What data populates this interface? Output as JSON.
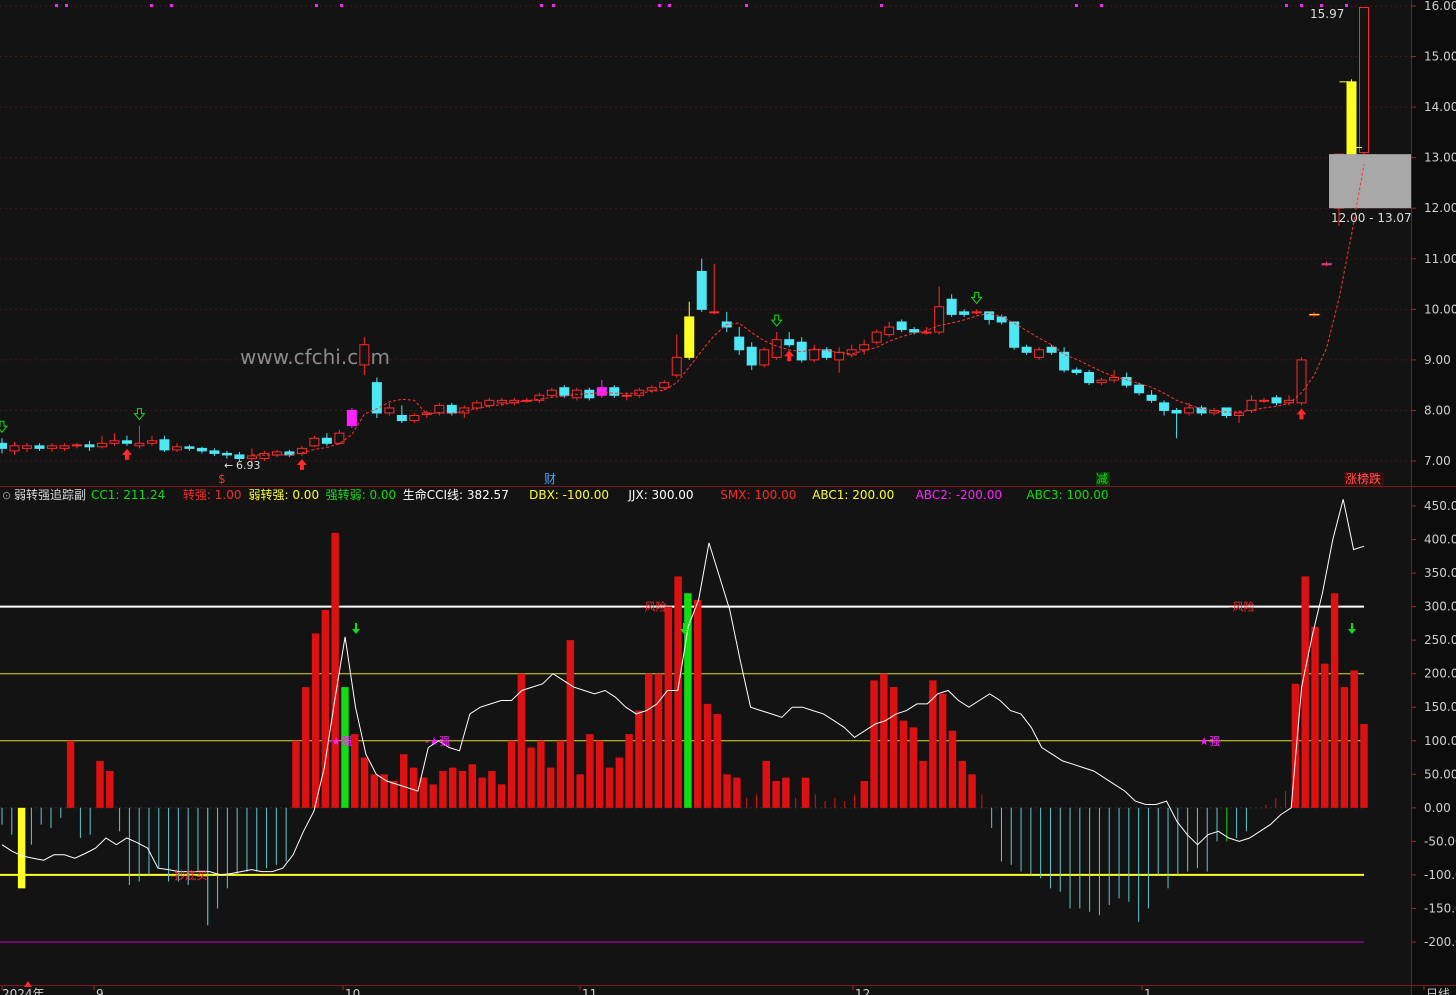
{
  "watermark": "www.cfchi.com",
  "colors": {
    "bg": "#141414",
    "axis_bg": "#0b0b0b",
    "grid": "#3a0f0f",
    "up": "#ff2a2a",
    "down": "#4ee7f5",
    "yellow": "#ffff22",
    "magenta": "#ff22ff",
    "green": "#11dd11",
    "white": "#ffffff",
    "purple": "#c000c0",
    "gray_box": "#a8a8a8"
  },
  "main_panel": {
    "y_ticks": [
      "16.00",
      "15.00",
      "14.00",
      "13.00",
      "12.00",
      "11.00",
      "10.00",
      "9.00",
      "8.00",
      "7.00"
    ],
    "low_label": "6.93",
    "high_label": "15.97",
    "range_label": "12.00 - 13.07",
    "event_labels": [
      {
        "text": "$",
        "color": "#ff2a2a"
      },
      {
        "text": "财",
        "color": "#4ea0ff"
      },
      {
        "text": "减",
        "color": "#11dd11"
      },
      {
        "text": "涨榜跌",
        "color": "#ff4444"
      }
    ]
  },
  "indicator": {
    "title": "弱转强追踪副",
    "values": [
      {
        "label": "CC1",
        "value": "211.24",
        "color": "#11dd11"
      },
      {
        "label": "转强",
        "value": "1.00",
        "color": "#ff2a2a"
      },
      {
        "label": "弱转强",
        "value": "0.00",
        "color": "#ffff22"
      },
      {
        "label": "强转弱",
        "value": "0.00",
        "color": "#11dd11"
      },
      {
        "label": "生命CCI线",
        "value": "382.57",
        "color": "#ffffff"
      },
      {
        "label": "DBX",
        "value": "-100.00",
        "color": "#ffff22"
      },
      {
        "label": "JJX",
        "value": "300.00",
        "color": "#ffffff"
      },
      {
        "label": "SMX",
        "value": "100.00",
        "color": "#ff2a2a"
      },
      {
        "label": "ABC1",
        "value": "200.00",
        "color": "#ffff22"
      },
      {
        "label": "ABC2",
        "value": "-200.00",
        "color": "#ff22ff"
      },
      {
        "label": "ABC3",
        "value": "100.00",
        "color": "#11dd11"
      }
    ],
    "y_ticks": [
      "450.00",
      "400.00",
      "350.00",
      "300.00",
      "250.00",
      "200.00",
      "150.00",
      "100.00",
      "50.00",
      "0.00",
      "-50.00",
      "-100.00",
      "-150.00",
      "-200.00"
    ],
    "annotations": [
      {
        "text": "-抄底买",
        "color": "#ff2a2a"
      },
      {
        "text": "-★强",
        "color": "#ff22ff"
      },
      {
        "text": "-★强",
        "color": "#ff22ff"
      },
      {
        "text": "-风险",
        "color": "#ff2a2a"
      },
      {
        "text": "★强",
        "color": "#ff22ff"
      },
      {
        "text": "-风险",
        "color": "#ff2a2a"
      }
    ]
  },
  "x_axis": {
    "labels": [
      "2024年",
      "9",
      "10",
      "11",
      "12",
      "1",
      "日线"
    ]
  },
  "chart_data": [
    {
      "type": "candlestick",
      "title": "",
      "y_ticks": [
        7,
        8,
        9,
        10,
        11,
        12,
        13,
        14,
        15,
        16
      ],
      "ylim": [
        6.75,
        16.1
      ],
      "grid": true,
      "candles": [
        [
          7.35,
          7.25,
          7.45,
          7.15
        ],
        [
          7.2,
          7.3,
          7.38,
          7.12
        ],
        [
          7.25,
          7.3,
          7.36,
          7.18
        ],
        [
          7.3,
          7.25,
          7.35,
          7.2
        ],
        [
          7.25,
          7.3,
          7.35,
          7.18
        ],
        [
          7.25,
          7.3,
          7.35,
          7.2
        ],
        [
          7.3,
          7.32,
          7.36,
          7.25
        ],
        [
          7.32,
          7.28,
          7.4,
          7.2
        ],
        [
          7.28,
          7.35,
          7.5,
          7.25
        ],
        [
          7.35,
          7.4,
          7.55,
          7.3
        ],
        [
          7.4,
          7.35,
          7.5,
          7.3
        ],
        [
          7.3,
          7.35,
          7.7,
          7.25
        ],
        [
          7.35,
          7.4,
          7.5,
          7.3
        ],
        [
          7.42,
          7.22,
          7.5,
          7.18
        ],
        [
          7.22,
          7.28,
          7.35,
          7.18
        ],
        [
          7.28,
          7.25,
          7.32,
          7.2
        ],
        [
          7.25,
          7.2,
          7.28,
          7.15
        ],
        [
          7.2,
          7.15,
          7.25,
          7.1
        ],
        [
          7.15,
          7.12,
          7.2,
          7.05
        ],
        [
          7.12,
          7.05,
          7.18,
          7.0
        ],
        [
          7.05,
          7.1,
          7.25,
          6.93
        ],
        [
          7.05,
          7.15,
          7.2,
          7.0
        ],
        [
          7.12,
          7.18,
          7.22,
          7.08
        ],
        [
          7.18,
          7.12,
          7.22,
          7.08
        ],
        [
          7.15,
          7.25,
          7.3,
          7.1
        ],
        [
          7.3,
          7.45,
          7.5,
          7.28
        ],
        [
          7.45,
          7.35,
          7.55,
          7.3
        ],
        [
          7.35,
          7.55,
          7.62,
          7.32
        ],
        [
          7.7,
          8.0,
          8.05,
          7.65
        ],
        [
          8.9,
          9.3,
          9.45,
          8.7
        ],
        [
          8.55,
          7.95,
          8.65,
          7.85
        ],
        [
          7.95,
          8.05,
          8.15,
          7.9
        ],
        [
          7.9,
          7.8,
          8.1,
          7.75
        ],
        [
          7.8,
          7.9,
          7.95,
          7.75
        ],
        [
          7.92,
          7.95,
          8.0,
          7.85
        ],
        [
          7.95,
          8.1,
          8.15,
          7.9
        ],
        [
          8.1,
          7.95,
          8.15,
          7.9
        ],
        [
          7.95,
          8.05,
          8.1,
          7.85
        ],
        [
          8.05,
          8.15,
          8.2,
          8.0
        ],
        [
          8.1,
          8.2,
          8.25,
          8.05
        ],
        [
          8.15,
          8.2,
          8.25,
          8.1
        ],
        [
          8.15,
          8.2,
          8.25,
          8.1
        ],
        [
          8.2,
          8.2,
          8.25,
          8.15
        ],
        [
          8.2,
          8.3,
          8.35,
          8.15
        ],
        [
          8.3,
          8.4,
          8.45,
          8.25
        ],
        [
          8.45,
          8.3,
          8.5,
          8.25
        ],
        [
          8.25,
          8.4,
          8.45,
          8.2
        ],
        [
          8.4,
          8.25,
          8.45,
          8.2
        ],
        [
          8.3,
          8.45,
          8.6,
          8.25
        ],
        [
          8.45,
          8.3,
          8.5,
          8.25
        ],
        [
          8.3,
          8.3,
          8.35,
          8.2
        ],
        [
          8.3,
          8.4,
          8.45,
          8.25
        ],
        [
          8.4,
          8.45,
          8.5,
          8.35
        ],
        [
          8.45,
          8.55,
          8.6,
          8.4
        ],
        [
          8.7,
          9.05,
          9.5,
          8.65
        ],
        [
          9.05,
          9.85,
          10.15,
          9.0
        ],
        [
          10.75,
          10.0,
          11.0,
          9.95
        ],
        [
          9.95,
          9.95,
          10.9,
          9.9
        ],
        [
          9.75,
          9.65,
          9.95,
          9.55
        ],
        [
          9.45,
          9.2,
          9.65,
          9.1
        ],
        [
          9.25,
          8.9,
          9.35,
          8.8
        ],
        [
          8.9,
          9.2,
          9.25,
          8.85
        ],
        [
          9.05,
          9.4,
          9.55,
          9.0
        ],
        [
          9.4,
          9.3,
          9.55,
          9.25
        ],
        [
          9.35,
          9.0,
          9.45,
          8.95
        ],
        [
          9.0,
          9.2,
          9.3,
          8.95
        ],
        [
          9.2,
          9.05,
          9.25,
          9.0
        ],
        [
          9.0,
          9.15,
          9.25,
          8.75
        ],
        [
          9.1,
          9.2,
          9.3,
          9.05
        ],
        [
          9.2,
          9.3,
          9.4,
          9.1
        ],
        [
          9.35,
          9.55,
          9.6,
          9.3
        ],
        [
          9.5,
          9.65,
          9.75,
          9.45
        ],
        [
          9.75,
          9.6,
          9.8,
          9.55
        ],
        [
          9.6,
          9.55,
          9.65,
          9.5
        ],
        [
          9.55,
          9.55,
          9.65,
          9.5
        ],
        [
          9.55,
          10.05,
          10.45,
          9.5
        ],
        [
          10.2,
          9.9,
          10.3,
          9.85
        ],
        [
          9.95,
          9.9,
          10.0,
          9.85
        ],
        [
          9.95,
          9.95,
          10.0,
          9.9
        ],
        [
          9.95,
          9.8,
          9.95,
          9.7
        ],
        [
          9.85,
          9.75,
          9.9,
          9.7
        ],
        [
          9.75,
          9.25,
          9.75,
          9.2
        ],
        [
          9.25,
          9.15,
          9.3,
          9.1
        ],
        [
          9.05,
          9.2,
          9.25,
          9.0
        ],
        [
          9.25,
          9.15,
          9.3,
          9.1
        ],
        [
          9.15,
          8.8,
          9.25,
          8.75
        ],
        [
          8.8,
          8.75,
          8.85,
          8.7
        ],
        [
          8.75,
          8.55,
          8.8,
          8.5
        ],
        [
          8.55,
          8.6,
          8.65,
          8.5
        ],
        [
          8.6,
          8.65,
          8.8,
          8.55
        ],
        [
          8.65,
          8.5,
          8.75,
          8.45
        ],
        [
          8.5,
          8.35,
          8.55,
          8.3
        ],
        [
          8.3,
          8.2,
          8.4,
          8.15
        ],
        [
          8.15,
          8.0,
          8.2,
          7.9
        ],
        [
          8.0,
          7.95,
          8.05,
          7.45
        ],
        [
          7.95,
          8.05,
          8.15,
          7.9
        ],
        [
          8.05,
          7.95,
          8.1,
          7.9
        ],
        [
          7.95,
          8.0,
          8.05,
          7.9
        ],
        [
          8.05,
          7.9,
          8.05,
          7.85
        ],
        [
          7.9,
          7.95,
          8.0,
          7.75
        ],
        [
          8.0,
          8.2,
          8.3,
          7.95
        ],
        [
          8.2,
          8.2,
          8.25,
          8.15
        ],
        [
          8.25,
          8.15,
          8.3,
          8.1
        ],
        [
          8.15,
          8.2,
          8.3,
          8.1
        ],
        [
          8.15,
          9.0,
          9.05,
          8.1
        ],
        [
          9.9,
          9.9,
          9.95,
          9.85
        ],
        [
          10.9,
          10.9,
          10.95,
          10.85
        ],
        [
          12.0,
          13.07,
          13.07,
          11.65
        ],
        [
          13.07,
          14.5,
          14.55,
          13.0
        ],
        [
          13.1,
          15.97,
          15.97,
          13.05
        ]
      ],
      "special_candles": [
        {
          "index": 28,
          "color": "#ff22ff"
        },
        {
          "index": 48,
          "color": "#ff22ff"
        },
        {
          "index": 55,
          "color": "#ffff22"
        },
        {
          "index": 108,
          "color": "#ffff22"
        }
      ],
      "gap_box": {
        "low": 12.0,
        "high": 13.07
      }
    },
    {
      "type": "bar",
      "title": "",
      "ylim": [
        -230,
        470
      ],
      "y_ticks": [
        450,
        400,
        350,
        300,
        250,
        200,
        150,
        100,
        50,
        0,
        -50,
        -100,
        -150,
        -200
      ],
      "reference_lines": [
        300,
        200,
        100,
        -100,
        -200
      ],
      "bars": [
        -25,
        -40,
        -120,
        -55,
        -25,
        -30,
        -15,
        100,
        -45,
        -40,
        70,
        55,
        -35,
        -115,
        -110,
        -100,
        -90,
        -110,
        -110,
        -115,
        -95,
        -175,
        -150,
        -120,
        -100,
        -95,
        -95,
        -90,
        -85,
        -80,
        100,
        180,
        260,
        295,
        410,
        180,
        110,
        75,
        50,
        50,
        40,
        80,
        60,
        45,
        35,
        55,
        60,
        55,
        65,
        45,
        55,
        35,
        100,
        200,
        90,
        100,
        60,
        100,
        250,
        50,
        110,
        100,
        60,
        75,
        110,
        145,
        200,
        200,
        300,
        345,
        320,
        310,
        155,
        140,
        50,
        45,
        15,
        20,
        70,
        40,
        45,
        15,
        45,
        20,
        10,
        15,
        10,
        20,
        40,
        190,
        200,
        180,
        130,
        120,
        70,
        190,
        170,
        115,
        70,
        50,
        20,
        -30,
        -80,
        -85,
        -95,
        -100,
        -105,
        -120,
        -125,
        -150,
        -150,
        -155,
        -160,
        -145,
        -135,
        -140,
        -170,
        -150,
        -100,
        -120,
        -100,
        -95,
        -90,
        -95,
        -50,
        -50,
        -45,
        -35,
        0,
        5,
        15,
        25,
        185,
        345,
        270,
        215,
        320,
        180,
        205,
        125
      ],
      "bar_colors": {
        "21": "#4ee7f5",
        "2": "#ffff22",
        "35": "#11dd11",
        "70": "#11dd11",
        "125": "#11dd11"
      },
      "line": [
        -55,
        -65,
        -72,
        -75,
        -78,
        -70,
        -70,
        -75,
        -68,
        -60,
        -45,
        -55,
        -45,
        -52,
        -60,
        -90,
        -92,
        -95,
        -95,
        -95,
        -95,
        -100,
        -98,
        -95,
        -92,
        -95,
        -95,
        -90,
        -70,
        -35,
        -5,
        60,
        160,
        255,
        150,
        80,
        50,
        40,
        35,
        30,
        25,
        90,
        100,
        90,
        85,
        140,
        150,
        155,
        160,
        160,
        175,
        180,
        185,
        200,
        190,
        180,
        175,
        170,
        175,
        165,
        150,
        140,
        145,
        155,
        175,
        175,
        270,
        310,
        395,
        345,
        295,
        220,
        150,
        145,
        140,
        135,
        150,
        150,
        145,
        140,
        130,
        120,
        105,
        115,
        125,
        130,
        140,
        145,
        155,
        155,
        170,
        175,
        160,
        150,
        160,
        170,
        160,
        145,
        140,
        120,
        90,
        80,
        70,
        65,
        60,
        55,
        45,
        35,
        25,
        10,
        5,
        5,
        10,
        -20,
        -40,
        -55,
        -40,
        -35,
        -45,
        -50,
        -45,
        -35,
        -25,
        -10,
        0,
        180,
        255,
        320,
        400,
        460,
        385,
        390
      ],
      "annotations_idx": [
        {
          "bar": 18,
          "value": -100
        },
        {
          "bar": 34,
          "value": 100
        },
        {
          "bar": 44,
          "value": 100
        },
        {
          "bar": 66,
          "value": 300
        },
        {
          "bar": 123,
          "value": 100
        },
        {
          "bar": 126,
          "value": 300
        }
      ]
    }
  ]
}
